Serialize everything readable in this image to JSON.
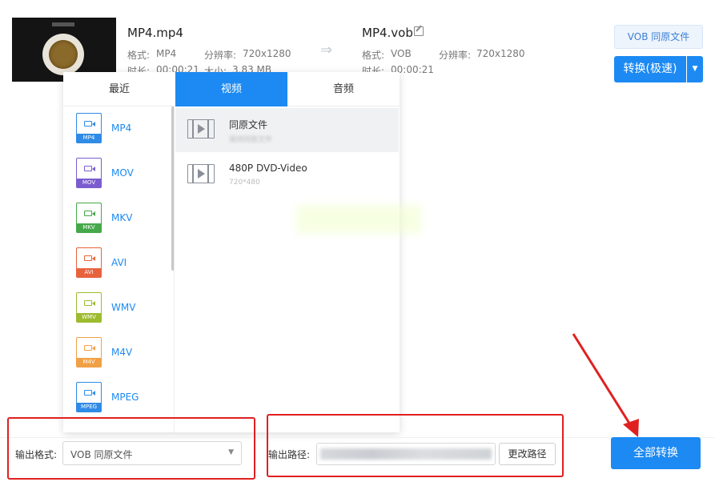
{
  "source": {
    "filename": "MP4.mp4",
    "format_label": "格式:",
    "format": "MP4",
    "resolution_label": "分辨率:",
    "resolution": "720x1280",
    "duration_label": "时长:",
    "duration": "00:00:21",
    "size_label": "大小:",
    "size": "3.83 MB"
  },
  "target": {
    "filename": "MP4.vob",
    "format_label": "格式:",
    "format": "VOB",
    "resolution_label": "分辨率:",
    "resolution": "720x1280",
    "duration_label": "时长:",
    "duration": "00:00:21"
  },
  "actions": {
    "profile_button": "VOB 同原文件",
    "convert_button": "转换(极速)",
    "dropdown_glyph": "▼"
  },
  "popup": {
    "tabs": [
      "最近",
      "视频",
      "音频"
    ],
    "active_tab": 1,
    "formats": [
      {
        "label": "MP4",
        "color": "#2f8be6"
      },
      {
        "label": "MOV",
        "color": "#7b5ccf"
      },
      {
        "label": "MKV",
        "color": "#45a849"
      },
      {
        "label": "AVI",
        "color": "#e8623c"
      },
      {
        "label": "WMV",
        "color": "#9dbb2f"
      },
      {
        "label": "M4V",
        "color": "#f1a046"
      },
      {
        "label": "MPEG",
        "color": "#2f8be6"
      }
    ],
    "presets": [
      {
        "title": "同原文件",
        "sub": "保持同原文件"
      },
      {
        "title": "480P DVD-Video",
        "sub": "720*480"
      }
    ]
  },
  "bottom": {
    "output_format_label": "输出格式:",
    "output_format_value": "VOB 同原文件",
    "output_path_label": "输出路径:",
    "change_path_button": "更改路径",
    "convert_all_button": "全部转换"
  },
  "colors": {
    "accent": "#1c8af2",
    "annotation_red": "#e02020"
  }
}
